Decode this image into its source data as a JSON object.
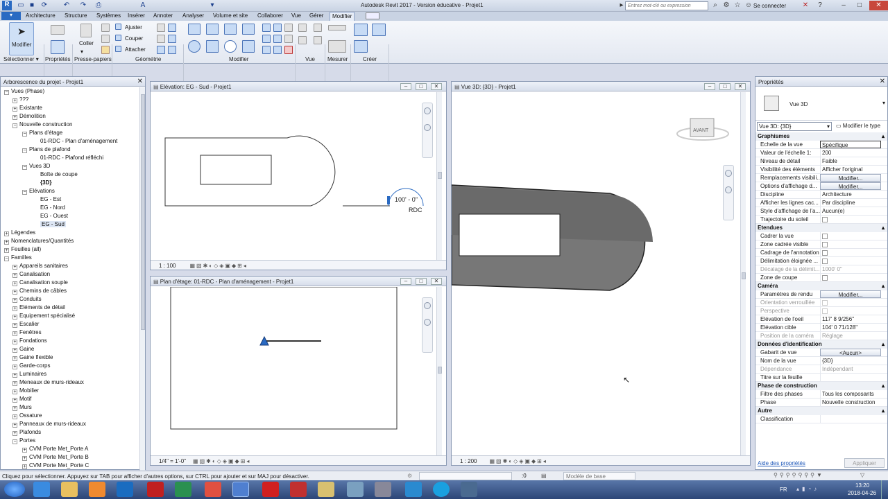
{
  "window": {
    "title": "Autodesk Revit 2017 - Version éducative -   Projet1",
    "search_placeholder": "Entrez mot-clé ou expression",
    "signin": "Se connecter"
  },
  "menu": [
    "Architecture",
    "Structure",
    "Systèmes",
    "Insérer",
    "Annoter",
    "Analyser",
    "Volume et site",
    "Collaborer",
    "Vue",
    "Gérer",
    "Modifier"
  ],
  "ribbon": {
    "modify_label": "Modifier",
    "paste_label": "Coller",
    "ajuster": "Ajuster",
    "couper": "Couper",
    "attacher": "Attacher",
    "panels": [
      "Sélectionner ▾",
      "Propriétés",
      "Presse-papiers",
      "Géométrie",
      "Modifier",
      "Vue",
      "Mesurer",
      "Créer"
    ]
  },
  "browser": {
    "title": "Arborescence du projet - Projet1",
    "items": [
      "Vues (Phase)",
      "???",
      "Existante",
      "Démolition",
      "Nouvelle construction",
      "Plans d'étage",
      "01-RDC - Plan d'aménagement",
      "Plans de plafond",
      "01-RDC - Plafond réfléchi",
      "Vues 3D",
      "Boîte de coupe",
      "{3D}",
      "Elévations",
      "EG - Est",
      "EG - Nord",
      "EG - Ouest",
      "EG - Sud",
      "Légendes",
      "Nomenclatures/Quantités",
      "Feuilles (all)",
      "Familles",
      "Appareils sanitaires",
      "Canalisation",
      "Canalisation souple",
      "Chemins de câbles",
      "Conduits",
      "Eléments de détail",
      "Equipement spécialisé",
      "Escalier",
      "Fenêtres",
      "Fondations",
      "Gaine",
      "Gaine flexible",
      "Garde-corps",
      "Luminaires",
      "Meneaux de murs-rideaux",
      "Mobilier",
      "Motif",
      "Murs",
      "Ossature",
      "Panneaux de murs-rideaux",
      "Plafonds",
      "Portes",
      "CVM Porte Met_Porte A",
      "CVM Porte Met_Porte B",
      "CVM Porte Met_Porte C"
    ]
  },
  "views": {
    "elevation": {
      "title": "Elévation: EG - Sud - Projet1",
      "scale": "1 : 100",
      "level_value": "100' - 0\"",
      "level_name": "RDC"
    },
    "plan": {
      "title": "Plan d'étage: 01-RDC - Plan d'aménagement - Projet1",
      "scale": "1/4\" = 1'-0\""
    },
    "view3d": {
      "title": "Vue 3D: {3D} - Projet1",
      "scale": "1 : 200",
      "viewcube": "AVANT"
    }
  },
  "properties": {
    "title": "Propriétés",
    "type_name": "Vue 3D",
    "type_select": "Vue 3D: {3D}",
    "edit_type": "Modifier le type",
    "sections": {
      "graphismes": "Graphismes",
      "etendues": "Etendues",
      "camera": "Caméra",
      "identification": "Données d'identification",
      "phase": "Phase de construction",
      "autre": "Autre"
    },
    "graphismes": [
      [
        "Echelle de la vue",
        "Spécifique"
      ],
      [
        "Valeur de l'échelle    1:",
        "200"
      ],
      [
        "Niveau de détail",
        "Faible"
      ],
      [
        "Visibilité des éléments",
        "Afficher l'original"
      ],
      [
        "Remplacements visibili...",
        "Modifier..."
      ],
      [
        "Options d'affichage d...",
        "Modifier..."
      ],
      [
        "Discipline",
        "Architecture"
      ],
      [
        "Afficher les lignes cac...",
        "Par discipline"
      ],
      [
        "Style d'affichage de l'a...",
        "Aucun(e)"
      ],
      [
        "Trajectoire du soleil",
        ""
      ]
    ],
    "etendues": [
      [
        "Cadrer la vue",
        ""
      ],
      [
        "Zone cadrée visible",
        ""
      ],
      [
        "Cadrage de l'annotation",
        ""
      ],
      [
        "Délimitation éloignée ...",
        ""
      ],
      [
        "Décalage de la délimit...",
        "1000' 0\""
      ],
      [
        "Zone de coupe",
        ""
      ]
    ],
    "camera": [
      [
        "Paramètres de rendu",
        "Modifier..."
      ],
      [
        "Orientation verrouillée",
        ""
      ],
      [
        "Perspective",
        ""
      ],
      [
        "Elévation de l'oeil",
        "117'  8 9/256\""
      ],
      [
        "Elévation cible",
        "104'  0 71/128\""
      ],
      [
        "Position de la caméra",
        "Réglage"
      ]
    ],
    "identification": [
      [
        "Gabarit de vue",
        "<Aucun>"
      ],
      [
        "Nom de la vue",
        "{3D}"
      ],
      [
        "Dépendance",
        "Indépendant"
      ],
      [
        "Titre sur la feuille",
        ""
      ]
    ],
    "phase": [
      [
        "Filtre des phases",
        "Tous les composants"
      ],
      [
        "Phase",
        "Nouvelle construction"
      ]
    ],
    "autre": [
      [
        "Classification",
        ""
      ]
    ],
    "help": "Aide des propriétés",
    "apply": "Appliquer"
  },
  "status": {
    "text": "Cliquez pour sélectionner. Appuyez sur TAB pour afficher d'autres options, sur CTRL pour ajouter et sur MAJ pour désactiver.",
    "count": ":0",
    "model": "Modèle de base"
  },
  "clock": {
    "time": "13:20",
    "date": "2018-04-26",
    "lang": "FR"
  }
}
